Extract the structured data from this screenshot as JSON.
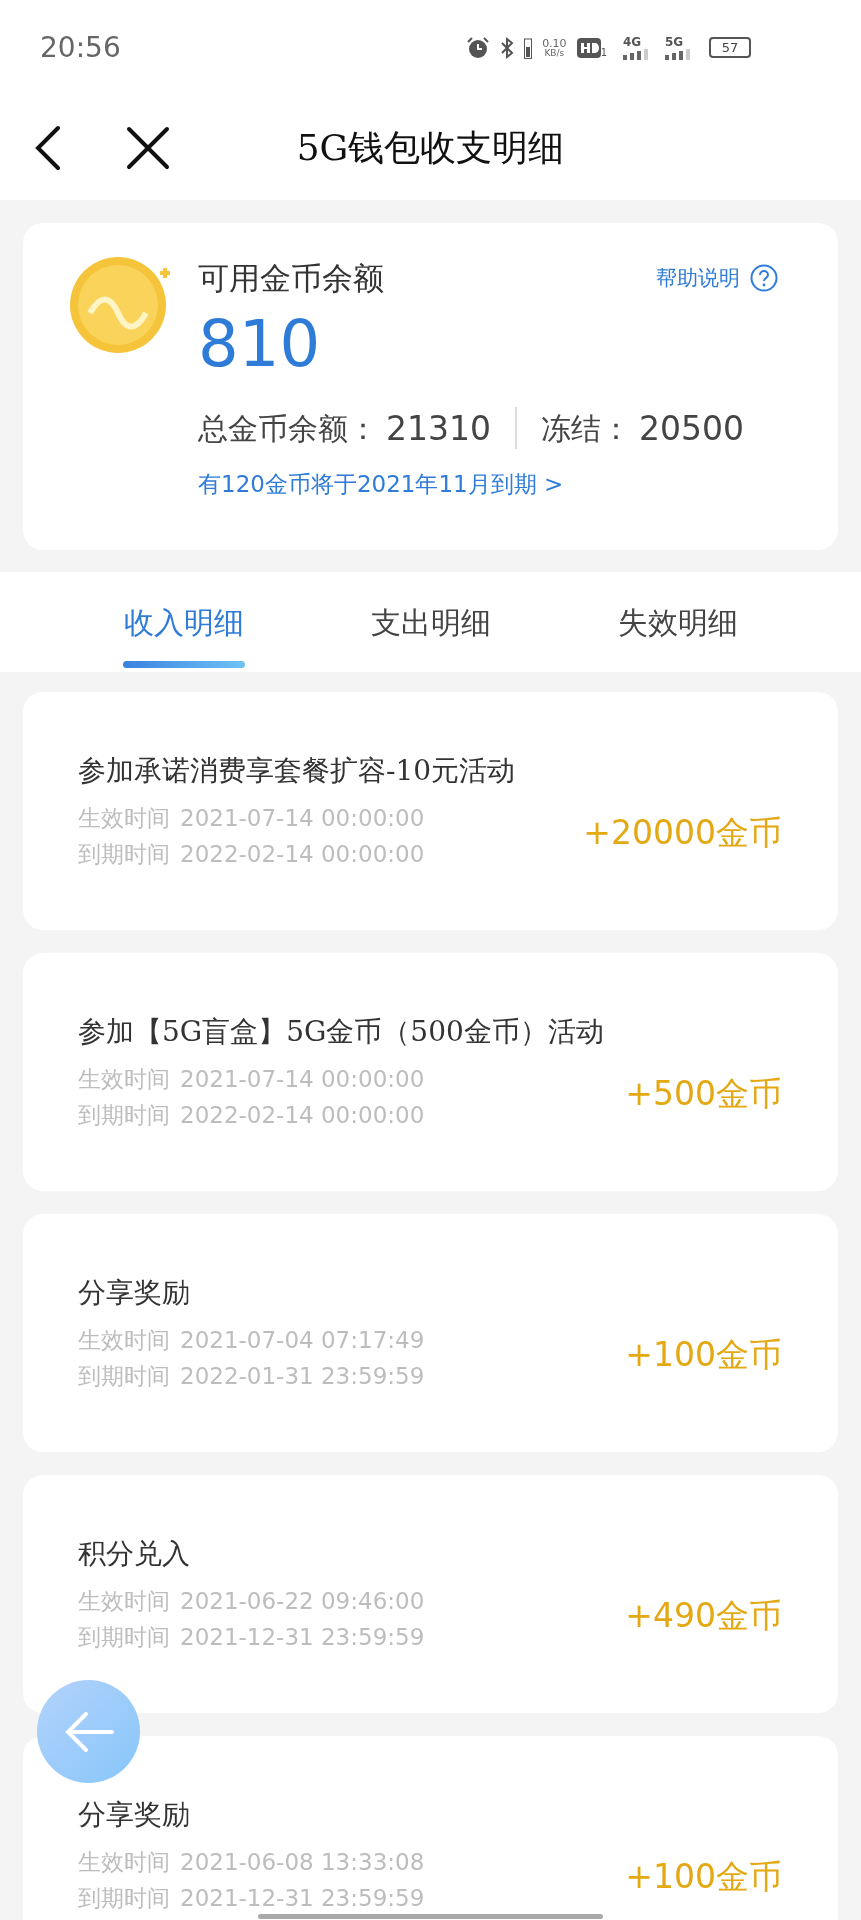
{
  "status_bar": {
    "time": "20:56",
    "net_speed_value": "0.10",
    "net_speed_unit": "KB/s",
    "hd_sim": "1",
    "signals": [
      {
        "label": "4G"
      },
      {
        "label": "5G"
      }
    ],
    "battery": "57"
  },
  "header": {
    "title": "5G钱包收支明细"
  },
  "balance": {
    "label": "可用金币余额",
    "help": "帮助说明",
    "amount": "810",
    "total_label": "总金币余额：",
    "total_value": "21310",
    "frozen_label": "冻结：",
    "frozen_value": "20500",
    "expiry_notice": "有120金币将于2021年11月到期 >"
  },
  "tabs": [
    {
      "label": "收入明细",
      "selected": true
    },
    {
      "label": "支出明细",
      "selected": false
    },
    {
      "label": "失效明细",
      "selected": false
    }
  ],
  "records": [
    {
      "title": "参加承诺消费享套餐扩容-10元活动",
      "lines": [
        {
          "label": "生效时间",
          "value": "2021-07-14 00:00:00"
        },
        {
          "label": "到期时间",
          "value": "2022-02-14 00:00:00"
        }
      ],
      "amount": "+20000金币"
    },
    {
      "title": "参加【5G盲盒】5G金币（500金币）活动",
      "lines": [
        {
          "label": "生效时间",
          "value": "2021-07-14 00:00:00"
        },
        {
          "label": "到期时间",
          "value": "2022-02-14 00:00:00"
        }
      ],
      "amount": "+500金币"
    },
    {
      "title": "分享奖励",
      "lines": [
        {
          "label": "生效时间",
          "value": "2021-07-04 07:17:49"
        },
        {
          "label": "到期时间",
          "value": "2022-01-31 23:59:59"
        }
      ],
      "amount": "+100金币"
    },
    {
      "title": "积分兑入",
      "lines": [
        {
          "label": "生效时间",
          "value": "2021-06-22 09:46:00"
        },
        {
          "label": "到期时间",
          "value": "2021-12-31 23:59:59"
        }
      ],
      "amount": "+490金币"
    },
    {
      "title": "分享奖励",
      "lines": [
        {
          "label": "生效时间",
          "value": "2021-06-08 13:33:08"
        },
        {
          "label": "到期时间",
          "value": "2021-12-31 23:59:59"
        }
      ],
      "amount": "+100金币"
    }
  ]
}
